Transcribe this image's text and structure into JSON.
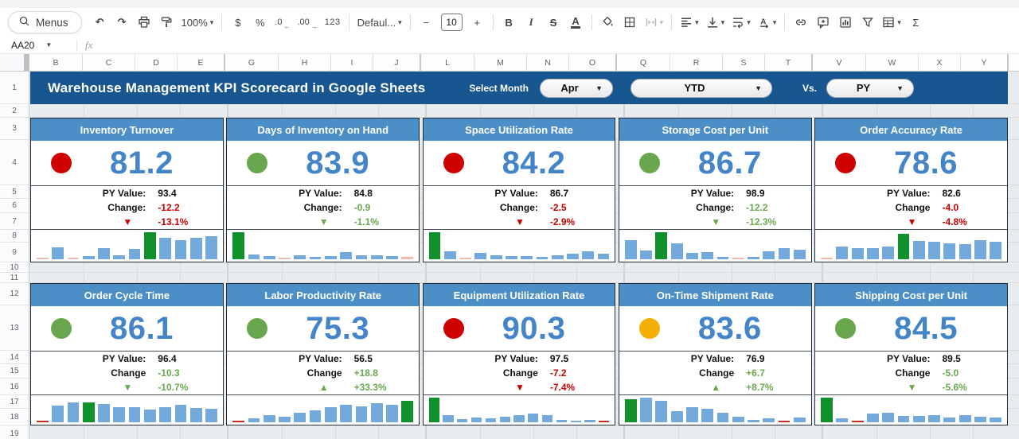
{
  "toolbar": {
    "items": [
      {
        "kind": "pill",
        "name": "menus-button",
        "icon": "search",
        "label": "Menus"
      },
      {
        "kind": "glyph",
        "name": "undo-button",
        "glyph": "↶"
      },
      {
        "kind": "glyph",
        "name": "redo-button",
        "glyph": "↷"
      },
      {
        "kind": "icon",
        "name": "print-button",
        "icon": "print"
      },
      {
        "kind": "icon",
        "name": "paint-format-button",
        "icon": "roller"
      },
      {
        "kind": "labelbtn",
        "name": "zoom-select",
        "label": "100%",
        "caret": true
      },
      {
        "kind": "sep"
      },
      {
        "kind": "glyph",
        "name": "format-currency-button",
        "glyph": "$",
        "plain": true
      },
      {
        "kind": "glyph",
        "name": "format-percent-button",
        "glyph": "%",
        "plain": true
      },
      {
        "kind": "glyph2",
        "name": "decrease-decimal-button",
        "glyph": ".0",
        "sub": "←"
      },
      {
        "kind": "glyph2",
        "name": "increase-decimal-button",
        "glyph": ".00",
        "sub": "→"
      },
      {
        "kind": "glyph",
        "name": "more-formats-button",
        "glyph": "123",
        "cls": "g-num",
        "plain": true
      },
      {
        "kind": "sep"
      },
      {
        "kind": "labelbtn",
        "name": "font-select",
        "label": "Defaul...",
        "caret": true
      },
      {
        "kind": "sep"
      },
      {
        "kind": "glyph",
        "name": "decrease-font-size-button",
        "glyph": "−",
        "plain": true
      },
      {
        "kind": "sizebox",
        "name": "font-size-input",
        "label": "10"
      },
      {
        "kind": "glyph",
        "name": "increase-font-size-button",
        "glyph": "+",
        "plain": true
      },
      {
        "kind": "sep"
      },
      {
        "kind": "glyph",
        "name": "bold-button",
        "glyph": "B"
      },
      {
        "kind": "glyph",
        "name": "italic-button",
        "glyph": "I",
        "cls": "g-italic"
      },
      {
        "kind": "glyph",
        "name": "strikethrough-button",
        "glyph": "S",
        "cls": "g-strike"
      },
      {
        "kind": "glyph",
        "name": "text-color-button",
        "glyph": "A",
        "cls": "g-underbar"
      },
      {
        "kind": "sep"
      },
      {
        "kind": "icon",
        "name": "fill-color-button",
        "icon": "fill"
      },
      {
        "kind": "icon",
        "name": "borders-button",
        "icon": "borders"
      },
      {
        "kind": "icon",
        "name": "merge-cells-button",
        "icon": "merge",
        "caret": true,
        "disabled": true
      },
      {
        "kind": "sep"
      },
      {
        "kind": "icon",
        "name": "horizontal-align-button",
        "icon": "align",
        "caret": true
      },
      {
        "kind": "icon",
        "name": "vertical-align-button",
        "icon": "valign",
        "caret": true
      },
      {
        "kind": "icon",
        "name": "text-wrap-button",
        "icon": "wrap",
        "caret": true
      },
      {
        "kind": "icon",
        "name": "text-rotation-button",
        "icon": "rotate",
        "caret": true
      },
      {
        "kind": "sep"
      },
      {
        "kind": "icon",
        "name": "insert-link-button",
        "icon": "link"
      },
      {
        "kind": "icon",
        "name": "insert-comment-button",
        "icon": "comment"
      },
      {
        "kind": "icon",
        "name": "insert-chart-button",
        "icon": "chart"
      },
      {
        "kind": "icon",
        "name": "create-filter-button",
        "icon": "filter"
      },
      {
        "kind": "icon",
        "name": "table-views-button",
        "icon": "table",
        "caret": true
      },
      {
        "kind": "glyph",
        "name": "functions-button",
        "glyph": "Σ",
        "plain": true
      }
    ]
  },
  "formula_bar": {
    "name_box_value": "AA20",
    "fx_label": "fx"
  },
  "columns": {
    "groups": [
      [
        "B",
        "C",
        "D",
        "E"
      ],
      [
        "G",
        "H",
        "I",
        "J"
      ],
      [
        "L",
        "M",
        "N",
        "O"
      ],
      [
        "Q",
        "R",
        "S",
        "T"
      ],
      [
        "V",
        "W",
        "X",
        "Y"
      ]
    ]
  },
  "rows": [
    "1",
    "2",
    "3",
    "4",
    "5",
    "6",
    "7",
    "8",
    "9",
    "10",
    "11",
    "12",
    "13",
    "14",
    "15",
    "16",
    "17",
    "18",
    "19"
  ],
  "banner": {
    "title": "Warehouse Management KPI Scorecard in Google Sheets",
    "select_month_label": "Select Month",
    "month_value": "Apr",
    "period_value": "YTD",
    "vs_label": "Vs.",
    "compare_value": "PY"
  },
  "colors": {
    "banner_bg": "#18568F",
    "card_header_bg": "#4B8FC6",
    "value_text": "#4385C8",
    "status_red": "#CE0000",
    "status_green": "#69A74E",
    "status_yellow": "#F2AF00",
    "neg_text": "#CC0000",
    "pos_text": "#6AA84F",
    "spark_blue": "#74A9DC",
    "spark_green": "#11912B",
    "spark_pink": "#F2BCB2",
    "spark_red": "#D02A20"
  },
  "kpi_cards": [
    {
      "title": "Inventory Turnover",
      "status": "red",
      "value": "81.2",
      "py_label": "PY Value:",
      "py_value": "93.4",
      "change_label": "Change:",
      "change_value": "-12.2",
      "change_tone": "red",
      "trend": "down",
      "trend_pct": "-13.1%",
      "trend_tone": "red",
      "spark": [
        [
          5,
          "p"
        ],
        [
          45,
          "b"
        ],
        [
          5,
          "p"
        ],
        [
          12,
          "b"
        ],
        [
          40,
          "b"
        ],
        [
          16,
          "b"
        ],
        [
          38,
          "b"
        ],
        [
          100,
          "g"
        ],
        [
          78,
          "b"
        ],
        [
          70,
          "b"
        ],
        [
          78,
          "b"
        ],
        [
          84,
          "b"
        ]
      ]
    },
    {
      "title": "Days of Inventory on Hand",
      "status": "green",
      "value": "83.9",
      "py_label": "PY Value:",
      "py_value": "84.8",
      "change_label": "Change:",
      "change_value": "-0.9",
      "change_tone": "green",
      "trend": "down",
      "trend_pct": "-1.1%",
      "trend_tone": "green",
      "spark": [
        [
          100,
          "g"
        ],
        [
          18,
          "b"
        ],
        [
          12,
          "b"
        ],
        [
          6,
          "p"
        ],
        [
          15,
          "b"
        ],
        [
          8,
          "b"
        ],
        [
          12,
          "b"
        ],
        [
          26,
          "b"
        ],
        [
          14,
          "b"
        ],
        [
          16,
          "b"
        ],
        [
          12,
          "b"
        ],
        [
          8,
          "p"
        ]
      ]
    },
    {
      "title": "Space Utilization Rate",
      "status": "red",
      "value": "84.2",
      "py_label": "PY Value:",
      "py_value": "86.7",
      "change_label": "Change:",
      "change_value": "-2.5",
      "change_tone": "red",
      "trend": "down",
      "trend_pct": "-2.9%",
      "trend_tone": "red",
      "spark": [
        [
          100,
          "g"
        ],
        [
          30,
          "b"
        ],
        [
          6,
          "p"
        ],
        [
          25,
          "b"
        ],
        [
          16,
          "b"
        ],
        [
          12,
          "b"
        ],
        [
          12,
          "b"
        ],
        [
          10,
          "b"
        ],
        [
          16,
          "b"
        ],
        [
          20,
          "b"
        ],
        [
          28,
          "b"
        ],
        [
          22,
          "b"
        ]
      ]
    },
    {
      "title": "Storage Cost per Unit",
      "status": "green",
      "value": "86.7",
      "py_label": "PY Value:",
      "py_value": "98.9",
      "change_label": "Change:",
      "change_value": "-12.2",
      "change_tone": "green",
      "trend": "down",
      "trend_pct": "-12.3%",
      "trend_tone": "green",
      "spark": [
        [
          72,
          "b"
        ],
        [
          33,
          "b"
        ],
        [
          100,
          "g"
        ],
        [
          58,
          "b"
        ],
        [
          24,
          "b"
        ],
        [
          27,
          "b"
        ],
        [
          10,
          "b"
        ],
        [
          6,
          "p"
        ],
        [
          10,
          "b"
        ],
        [
          28,
          "b"
        ],
        [
          42,
          "b"
        ],
        [
          36,
          "b"
        ]
      ]
    },
    {
      "title": "Order Accuracy Rate",
      "status": "red",
      "value": "78.6",
      "py_label": "PY Value:",
      "py_value": "82.6",
      "change_label": "Change",
      "change_value": "-4.0",
      "change_tone": "red",
      "trend": "down",
      "trend_pct": "-4.8%",
      "trend_tone": "red",
      "spark": [
        [
          6,
          "p"
        ],
        [
          48,
          "b"
        ],
        [
          42,
          "b"
        ],
        [
          40,
          "b"
        ],
        [
          46,
          "b"
        ],
        [
          95,
          "g"
        ],
        [
          68,
          "b"
        ],
        [
          66,
          "b"
        ],
        [
          60,
          "b"
        ],
        [
          56,
          "b"
        ],
        [
          70,
          "b"
        ],
        [
          66,
          "b"
        ]
      ]
    },
    {
      "title": "Order Cycle Time",
      "status": "green",
      "value": "86.1",
      "py_label": "PY Value:",
      "py_value": "96.4",
      "change_label": "Change",
      "change_value": "-10.3",
      "change_tone": "green",
      "trend": "down",
      "trend_pct": "-10.7%",
      "trend_tone": "green",
      "spark": [
        [
          4,
          "r"
        ],
        [
          68,
          "b"
        ],
        [
          80,
          "b"
        ],
        [
          80,
          "g"
        ],
        [
          74,
          "b"
        ],
        [
          62,
          "b"
        ],
        [
          60,
          "b"
        ],
        [
          52,
          "b"
        ],
        [
          62,
          "b"
        ],
        [
          70,
          "b"
        ],
        [
          58,
          "b"
        ],
        [
          56,
          "b"
        ]
      ]
    },
    {
      "title": "Labor Productivity Rate",
      "status": "green",
      "value": "75.3",
      "py_label": "PY Value:",
      "py_value": "56.5",
      "change_label": "Change",
      "change_value": "+18.8",
      "change_tone": "green",
      "trend": "up",
      "trend_pct": "+33.3%",
      "trend_tone": "green",
      "spark": [
        [
          4,
          "r"
        ],
        [
          16,
          "b"
        ],
        [
          28,
          "b"
        ],
        [
          22,
          "b"
        ],
        [
          40,
          "b"
        ],
        [
          48,
          "b"
        ],
        [
          62,
          "b"
        ],
        [
          70,
          "b"
        ],
        [
          65,
          "b"
        ],
        [
          78,
          "b"
        ],
        [
          72,
          "b"
        ],
        [
          88,
          "g"
        ]
      ]
    },
    {
      "title": "Equipment Utilization Rate",
      "status": "red",
      "value": "90.3",
      "py_label": "PY Value:",
      "py_value": "97.5",
      "change_label": "Change",
      "change_value": "-7.2",
      "change_tone": "red",
      "trend": "down",
      "trend_pct": "-7.4%",
      "trend_tone": "red",
      "spark": [
        [
          100,
          "g"
        ],
        [
          30,
          "b"
        ],
        [
          12,
          "b"
        ],
        [
          20,
          "b"
        ],
        [
          16,
          "b"
        ],
        [
          24,
          "b"
        ],
        [
          30,
          "b"
        ],
        [
          34,
          "b"
        ],
        [
          28,
          "b"
        ],
        [
          10,
          "b"
        ],
        [
          8,
          "b"
        ],
        [
          10,
          "b"
        ],
        [
          4,
          "r"
        ]
      ]
    },
    {
      "title": "On-Time Shipment Rate",
      "status": "yellow",
      "value": "83.6",
      "py_label": "PY Value:",
      "py_value": "76.9",
      "change_label": "Change",
      "change_value": "+6.7",
      "change_tone": "green",
      "trend": "up",
      "trend_pct": "+8.7%",
      "trend_tone": "green",
      "spark": [
        [
          92,
          "g"
        ],
        [
          100,
          "b"
        ],
        [
          88,
          "b"
        ],
        [
          45,
          "b"
        ],
        [
          62,
          "b"
        ],
        [
          56,
          "b"
        ],
        [
          38,
          "b"
        ],
        [
          22,
          "b"
        ],
        [
          10,
          "b"
        ],
        [
          16,
          "b"
        ],
        [
          4,
          "r"
        ],
        [
          20,
          "b"
        ]
      ]
    },
    {
      "title": "Shipping Cost per Unit",
      "status": "green",
      "value": "84.5",
      "py_label": "PY Value:",
      "py_value": "89.5",
      "change_label": "Change",
      "change_value": "-5.0",
      "change_tone": "green",
      "trend": "down",
      "trend_pct": "-5.6%",
      "trend_tone": "green",
      "spark": [
        [
          100,
          "g"
        ],
        [
          15,
          "b"
        ],
        [
          4,
          "r"
        ],
        [
          35,
          "b"
        ],
        [
          38,
          "b"
        ],
        [
          26,
          "b"
        ],
        [
          26,
          "b"
        ],
        [
          30,
          "b"
        ],
        [
          20,
          "b"
        ],
        [
          28,
          "b"
        ],
        [
          24,
          "b"
        ],
        [
          20,
          "b"
        ]
      ]
    }
  ]
}
